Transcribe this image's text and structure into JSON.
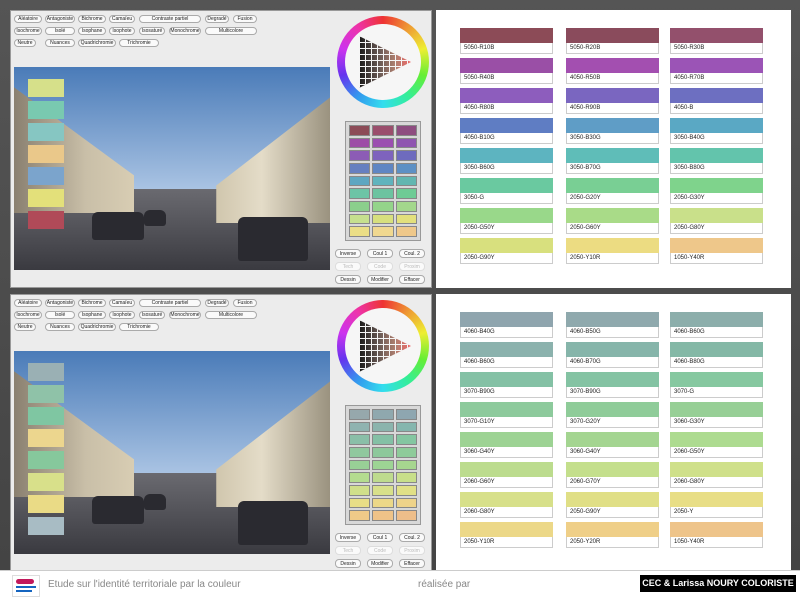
{
  "toolbar": {
    "row1": [
      "Aléatoire",
      "Antagoniste",
      "Bichrome",
      "Camaïeu",
      "Contraste partiel",
      "Degradé",
      "Fusion"
    ],
    "row2": [
      "Isochrome",
      "Isolé",
      "Isophane",
      "Isophote",
      "Isosaturé",
      "Monochrome",
      "Multicolore"
    ],
    "row3": [
      "Neutre",
      "Nuances",
      "Quadrichromie",
      "Trichromie"
    ]
  },
  "side_buttons": {
    "row1": [
      "Inverse",
      "Coul 1",
      "Coul. 2"
    ],
    "row2": [
      "Tech",
      "Code",
      "Proxim"
    ],
    "row3": [
      "Dessin",
      "Modifier",
      "Effacer"
    ]
  },
  "top": {
    "overlay_swatches": [
      "#d6e08a",
      "#79c9b0",
      "#86c6c2",
      "#eac88a",
      "#7ba4cc",
      "#e3e07a",
      "#b04a58"
    ],
    "palette": [
      "#8c4b57",
      "#9a4e6c",
      "#8e4d80",
      "#9d4da6",
      "#9b4fb0",
      "#8f55b0",
      "#8c5cb5",
      "#7e63bd",
      "#6e6bbe",
      "#667fc0",
      "#5f86c3",
      "#5d90c4",
      "#5ea6c1",
      "#60b3bd",
      "#62b6b0",
      "#6cc4a6",
      "#6cc3a0",
      "#6ecb95",
      "#8bcf8c",
      "#94d48a",
      "#a3d78c",
      "#c6e08e",
      "#d7e07e",
      "#e3e07c",
      "#ebde86",
      "#f0d890",
      "#efc88a"
    ],
    "swatches": [
      {
        "label": "5050-R10B",
        "color": "#8c4b57"
      },
      {
        "label": "5050-R20B",
        "color": "#8a4b5c"
      },
      {
        "label": "5050-R30B",
        "color": "#93506c"
      },
      {
        "label": "5050-R40B",
        "color": "#9a4fa6"
      },
      {
        "label": "4050-R50B",
        "color": "#a34fb0"
      },
      {
        "label": "4050-R70B",
        "color": "#9b54b6"
      },
      {
        "label": "4050-R80B",
        "color": "#8d5dbd"
      },
      {
        "label": "4050-R90B",
        "color": "#7a66c0"
      },
      {
        "label": "4050-B",
        "color": "#6d6fc1"
      },
      {
        "label": "4050-B10G",
        "color": "#5f7dc3"
      },
      {
        "label": "3050-B30G",
        "color": "#5f9dc6"
      },
      {
        "label": "3050-B40G",
        "color": "#5aa8c4"
      },
      {
        "label": "3050-B60G",
        "color": "#5db4c0"
      },
      {
        "label": "3050-B70G",
        "color": "#5fbdb8"
      },
      {
        "label": "3050-B80G",
        "color": "#63c4ac"
      },
      {
        "label": "3050-G",
        "color": "#6ac9a0"
      },
      {
        "label": "2050-G20Y",
        "color": "#79cf94"
      },
      {
        "label": "2050-G30Y",
        "color": "#7fd38c"
      },
      {
        "label": "2050-G50Y",
        "color": "#99d88a"
      },
      {
        "label": "2050-G60Y",
        "color": "#a9db88"
      },
      {
        "label": "2050-G80Y",
        "color": "#c9e08a"
      },
      {
        "label": "2050-G90Y",
        "color": "#d8e07e"
      },
      {
        "label": "2050-Y10R",
        "color": "#ecdc82"
      },
      {
        "label": "1050-Y40R",
        "color": "#eec78a"
      }
    ]
  },
  "bottom": {
    "overlay_swatches": [
      "#9ab0b4",
      "#8fc2a8",
      "#7fc6a2",
      "#ecd68e",
      "#86c89c",
      "#d8e08a",
      "#eadb86",
      "#a8bcc4"
    ],
    "palette": [
      "#96a8ac",
      "#8fa8ae",
      "#8ea6b0",
      "#8fb3b0",
      "#8bb4ad",
      "#85b6ae",
      "#8abfa8",
      "#84c0a5",
      "#84c6a1",
      "#90c89e",
      "#8dc89b",
      "#8ecb9a",
      "#98cf96",
      "#9dd494",
      "#a6d68f",
      "#b4dc8f",
      "#bedb8e",
      "#c8df8a",
      "#d0df8a",
      "#d8e08a",
      "#e1e086",
      "#e8de86",
      "#ecd888",
      "#eed38a",
      "#efca88",
      "#efc388",
      "#eebe8a"
    ],
    "swatches": [
      {
        "label": "4060-B40G",
        "color": "#8fa5ae"
      },
      {
        "label": "4060-B50G",
        "color": "#8fa9ad"
      },
      {
        "label": "4060-B60G",
        "color": "#8caeab"
      },
      {
        "label": "4060-B60G",
        "color": "#8bb2ad"
      },
      {
        "label": "4060-B70G",
        "color": "#86b5aa"
      },
      {
        "label": "4060-B80G",
        "color": "#84b8a6"
      },
      {
        "label": "3070-B90G",
        "color": "#84c1a5"
      },
      {
        "label": "3070-B90G",
        "color": "#84c3a3"
      },
      {
        "label": "3070-G",
        "color": "#86c8a0"
      },
      {
        "label": "3070-G10Y",
        "color": "#8dca9c"
      },
      {
        "label": "3070-G20Y",
        "color": "#8fcc99"
      },
      {
        "label": "3060-G30Y",
        "color": "#97cf96"
      },
      {
        "label": "3060-G40Y",
        "color": "#9dd394"
      },
      {
        "label": "3060-G40Y",
        "color": "#a4d591"
      },
      {
        "label": "2060-G50Y",
        "color": "#addb90"
      },
      {
        "label": "2060-G60Y",
        "color": "#bcdc8e"
      },
      {
        "label": "2060-G70Y",
        "color": "#c4df8c"
      },
      {
        "label": "2060-G80Y",
        "color": "#cfe08a"
      },
      {
        "label": "2060-G80Y",
        "color": "#d7e08a"
      },
      {
        "label": "2050-G90Y",
        "color": "#e0df86"
      },
      {
        "label": "2050-Y",
        "color": "#e8de86"
      },
      {
        "label": "2050-Y10R",
        "color": "#ecd888"
      },
      {
        "label": "2050-Y20R",
        "color": "#efcf88"
      },
      {
        "label": "1050-Y40R",
        "color": "#eec48a"
      }
    ]
  },
  "footer": {
    "study_text": "Etude sur l'identité territoriale par la couleur",
    "by_text": "réalisée par",
    "signature": "CEC & Larissa NOURY COLORISTE"
  }
}
